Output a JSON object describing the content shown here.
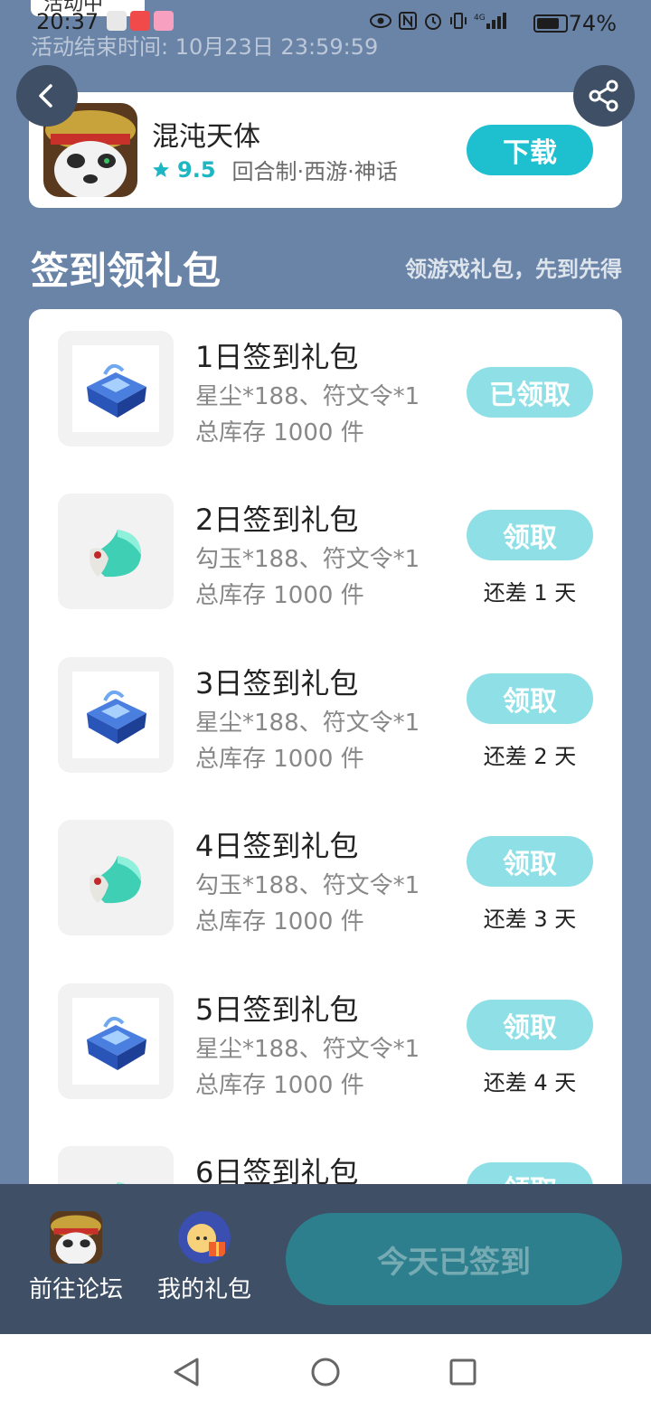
{
  "status_bar": {
    "time": "20:37",
    "activity_badge": "活动中",
    "battery": "74%"
  },
  "header": {
    "end_time": "活动结束时间: 10月23日 23:59:59"
  },
  "game": {
    "title": "混沌天体",
    "rating": "9.5",
    "tags": "回合制·西游·神话",
    "download_label": "下载"
  },
  "section": {
    "title": "签到领礼包",
    "subtitle": "领游戏礼包，先到先得"
  },
  "gifts": [
    {
      "name": "1日签到礼包",
      "content": "星尘*188、符文令*1",
      "stock": "总库存 1000 件",
      "button": "已领取",
      "remaining": "",
      "icon": "crystal-chest-icon"
    },
    {
      "name": "2日签到礼包",
      "content": "勾玉*188、符文令*1",
      "stock": "总库存 1000 件",
      "button": "领取",
      "remaining": "还差 1 天",
      "icon": "magatama-icon"
    },
    {
      "name": "3日签到礼包",
      "content": "星尘*188、符文令*1",
      "stock": "总库存 1000 件",
      "button": "领取",
      "remaining": "还差 2 天",
      "icon": "crystal-chest-icon"
    },
    {
      "name": "4日签到礼包",
      "content": "勾玉*188、符文令*1",
      "stock": "总库存 1000 件",
      "button": "领取",
      "remaining": "还差 3 天",
      "icon": "magatama-icon"
    },
    {
      "name": "5日签到礼包",
      "content": "星尘*188、符文令*1",
      "stock": "总库存 1000 件",
      "button": "领取",
      "remaining": "还差 4 天",
      "icon": "crystal-chest-icon"
    },
    {
      "name": "6日签到礼包",
      "content": "",
      "stock": "",
      "button": "领取",
      "remaining": "",
      "icon": "magatama-icon"
    }
  ],
  "bottom": {
    "forum_label": "前往论坛",
    "my_gifts_label": "我的礼包",
    "signed_label": "今天已签到"
  },
  "colors": {
    "background": "#6a84a8",
    "accent": "#1ec0cf",
    "claim_disabled": "#8fe0e6",
    "bottom_bar": "#3e4f66"
  }
}
